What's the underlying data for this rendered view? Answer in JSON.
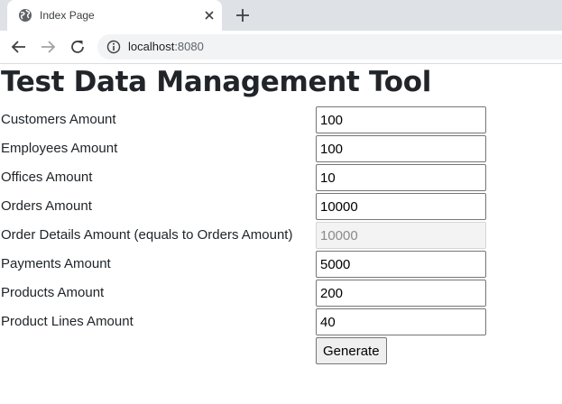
{
  "browser": {
    "tab_title": "Index Page",
    "url_host": "localhost",
    "url_port": ":8080"
  },
  "page": {
    "title": "Test Data Management Tool",
    "fields": [
      {
        "label": "Customers Amount",
        "value": "100",
        "disabled": false
      },
      {
        "label": "Employees Amount",
        "value": "100",
        "disabled": false
      },
      {
        "label": "Offices Amount",
        "value": "10",
        "disabled": false
      },
      {
        "label": "Orders Amount",
        "value": "10000",
        "disabled": false
      },
      {
        "label": "Order Details Amount (equals to Orders Amount)",
        "value": "10000",
        "disabled": true
      },
      {
        "label": "Payments Amount",
        "value": "5000",
        "disabled": false
      },
      {
        "label": "Products Amount",
        "value": "200",
        "disabled": false
      },
      {
        "label": "Product Lines Amount",
        "value": "40",
        "disabled": false
      }
    ],
    "generate_label": "Generate"
  },
  "icons": {
    "favicon": "globe-icon",
    "close": "close-icon",
    "new_tab": "plus-icon",
    "back": "arrow-left-icon",
    "forward": "arrow-right-icon",
    "reload": "reload-icon",
    "site_info": "info-icon"
  }
}
